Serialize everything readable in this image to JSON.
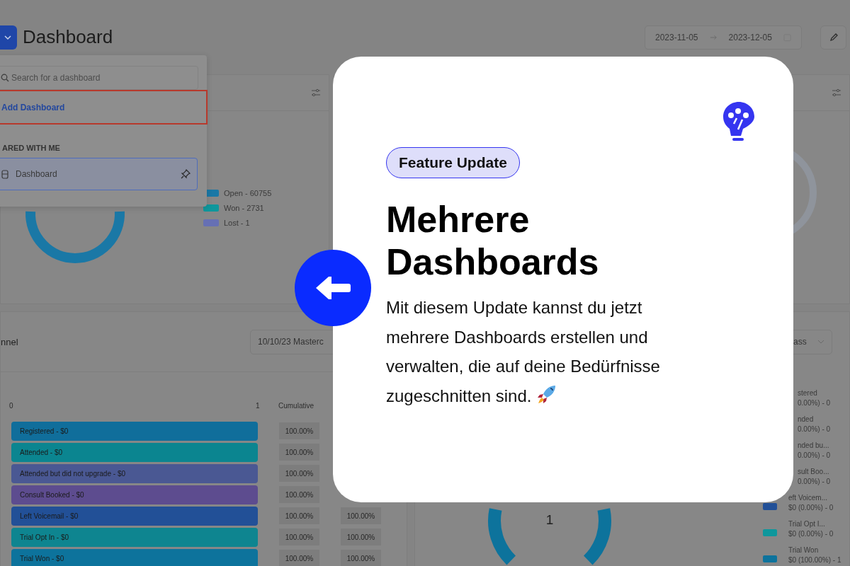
{
  "header": {
    "title": "Dashboard",
    "date_from": "2023-11-05",
    "date_to": "2023-12-05"
  },
  "dashboard_menu": {
    "search": {
      "placeholder": "Search for a dashboard"
    },
    "add_label": "Add Dashboard",
    "section": "ARED WITH ME",
    "items": [
      {
        "label": "Dashboard",
        "selected": true
      }
    ]
  },
  "status_panel": {
    "legend": [
      {
        "label": "Open - 60755",
        "color": "#1a78a6"
      },
      {
        "label": "Won - 2731",
        "color": "#0f979c"
      },
      {
        "label": "Lost - 1",
        "color": "#6670b4"
      }
    ]
  },
  "funnel_panel": {
    "title": "nnel",
    "filter_value": "10/10/23 Masterc",
    "axis": [
      "0",
      "1"
    ],
    "column_header": "Cumulative",
    "rows": [
      {
        "label": "Registered - $0",
        "color": "#106e9b",
        "cumulative": "100.00%"
      },
      {
        "label": "Attended - $0",
        "color": "#0b8590",
        "cumulative": "100.00%"
      },
      {
        "label": "Attended but did not upgrade - $0",
        "color": "#4a5893",
        "cumulative": "100.00%"
      },
      {
        "label": "Consult Booked - $0",
        "color": "#5d4c8f",
        "cumulative": "100.00%"
      },
      {
        "label": "Left Voicemail - $0",
        "color": "#225097",
        "cumulative": "100.00%",
        "column_2": "100.00%"
      },
      {
        "label": "Trial Opt In - $0",
        "color": "#0e8590",
        "cumulative": "100.00%",
        "column_2": "100.00%"
      },
      {
        "label": "Trial Won - $0",
        "color": "#0d739c",
        "cumulative": "100.00%",
        "column_2": "100.00%"
      }
    ]
  },
  "summary_panel": {
    "filter_value": "ass",
    "total": "1",
    "legend": [
      {
        "label": "stered",
        "value": "0.00%) - 0"
      },
      {
        "label": "nded",
        "value": "0.00%) - 0"
      },
      {
        "label": "nded bu...",
        "value": "0.00%) - 0"
      },
      {
        "label": "sult Boo...",
        "value": "0.00%) - 0"
      },
      {
        "label": "eft Voicem...",
        "value": "$0 (0.00%) - 0",
        "color": "#225097"
      },
      {
        "label": "Trial Opt I...",
        "value": "$0 (0.00%) - 0",
        "color": "#0e979c"
      },
      {
        "label": "Trial Won",
        "value": "$0 (100.00%) - 1",
        "color": "#0d739c"
      }
    ]
  },
  "feature_card": {
    "badge": "Feature Update",
    "title": "Mehrere Dashboards",
    "body": "Mit diesem Update kannst du jetzt mehrere Dashboards erstellen und verwalten, die auf deine Bedürfnisse zugeschnitten sind."
  }
}
